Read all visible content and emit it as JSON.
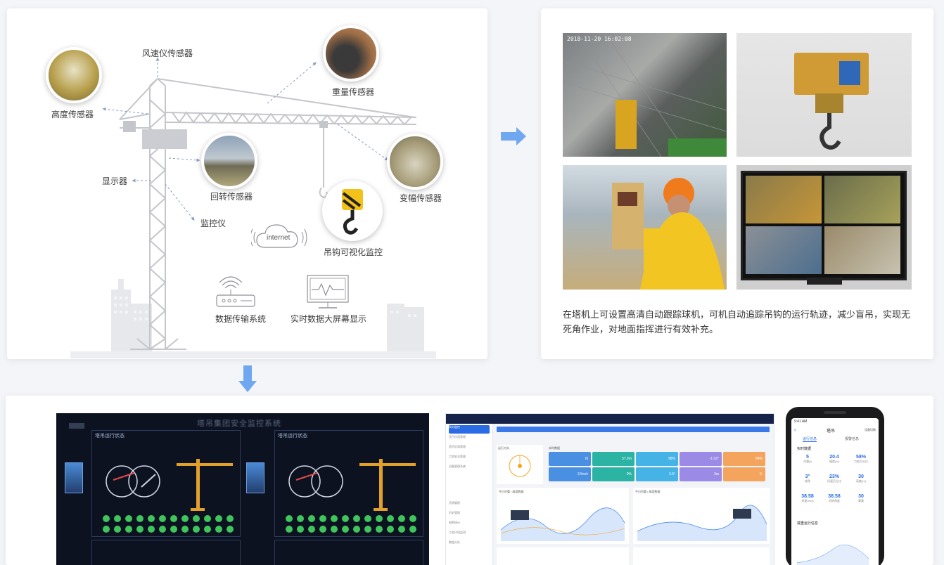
{
  "crane_diagram": {
    "labels": {
      "wind_sensor": "风速仪传感器",
      "height_sensor": "高度传感器",
      "weight_sensor": "重量传感器",
      "display": "显示器",
      "rotation_sensor": "回转传感器",
      "luffing_sensor": "变幅传感器",
      "monitor": "监控仪",
      "hook_monitor": "吊钩可视化监控",
      "internet": "internet",
      "data_transfer": "数据传输系统",
      "big_screen": "实时数据大屏幕显示"
    }
  },
  "photos_panel": {
    "timestamp_overlay": "2018-11-20 16:02:08",
    "caption": "在塔机上可设置高清自动跟踪球机，可机自动追踪吊钩的运行轨迹，减少盲吊，实现无死角作业，对地面指挥进行有效补充。"
  },
  "bottom": {
    "screen_title": "塔吊集团安全监控系统",
    "screen_panel_title_1": "塔吊运行状态",
    "screen_panel_title_2": "塔吊运行状态",
    "dashboard_title": "实时监控",
    "dashboard_menu": [
      "实时监控",
      "项目应用管理",
      "塔吊区域管理",
      "工地安全管理",
      "设备管理系统",
      "资源管理",
      "历史管理",
      "报警统计",
      "工地环境监测",
      "数据分析"
    ],
    "dashboard_section_1": "运行方向",
    "dashboard_section_2": "实时数据",
    "dashboard_chart_1": "今日吊重 / 高度数据",
    "dashboard_chart_2": "今日吊重 / 高度数据",
    "dashboard_tiles": [
      {
        "value": "0t",
        "color": "#4a90e2"
      },
      {
        "value": "57.9m",
        "color": "#2bb3a3"
      },
      {
        "value": "98%",
        "color": "#46b3e6"
      },
      {
        "value": "-1.02°",
        "color": "#9b8ae6"
      },
      {
        "value": "64%",
        "color": "#f5a45d"
      },
      {
        "value": "3.5m/s",
        "color": "#4a90e2"
      },
      {
        "value": "0%",
        "color": "#2bb3a3"
      },
      {
        "value": "3.5°",
        "color": "#46b3e6"
      },
      {
        "value": "3m",
        "color": "#9b8ae6"
      },
      {
        "value": "0.",
        "color": "#f5a45d"
      }
    ],
    "phone": {
      "time": "9:41 AM",
      "title": "塔吊",
      "right_action": "设备切换",
      "tab_1": "运行信息",
      "tab_2": "报警信息",
      "section_1": "实时数据",
      "stats": [
        {
          "value": "5",
          "label": "吊重(t)"
        },
        {
          "value": "20.4",
          "label": "幅度(m)"
        },
        {
          "value": "58%",
          "label": "力矩百分比"
        },
        {
          "value": "3°",
          "label": "倾角"
        },
        {
          "value": "23%",
          "label": "风速百分比"
        },
        {
          "value": "30",
          "label": "高度(m)"
        },
        {
          "value": "38.58",
          "label": "风速(m/s)"
        },
        {
          "value": "38.58",
          "label": "回转角度"
        },
        {
          "value": "30",
          "label": "载重"
        }
      ],
      "section_2": "载重运行信息"
    }
  },
  "colors": {
    "accent_arrow": "#6fa8f0",
    "diagram_line": "#8a9bc0",
    "crane_gray": "#c9cbd0"
  }
}
